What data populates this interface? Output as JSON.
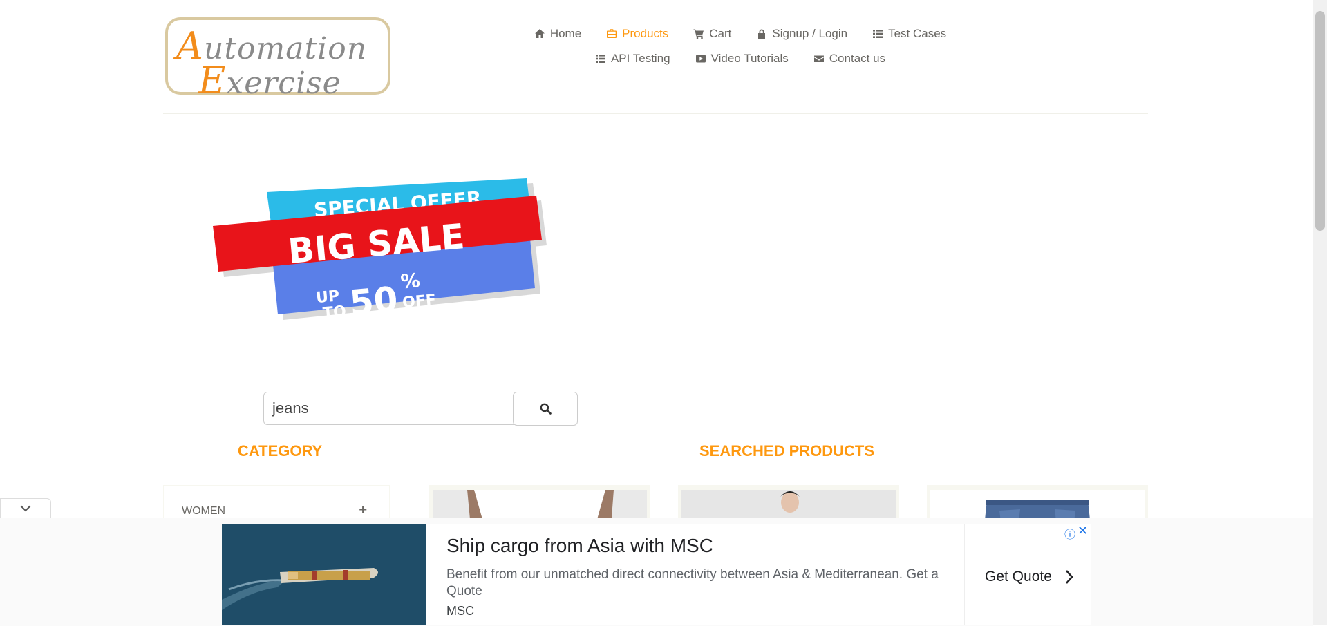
{
  "logo": {
    "line1_cap": "A",
    "line1_rest": "utomation",
    "line2_cap": "E",
    "line2_rest": "xercise"
  },
  "nav": {
    "items": [
      {
        "label": "Home",
        "icon": "home-icon"
      },
      {
        "label": "Products",
        "icon": "briefcase-icon",
        "active": true
      },
      {
        "label": "Cart",
        "icon": "cart-icon"
      },
      {
        "label": "Signup / Login",
        "icon": "lock-icon"
      },
      {
        "label": "Test Cases",
        "icon": "list-icon"
      },
      {
        "label": "API Testing",
        "icon": "list-icon"
      },
      {
        "label": "Video Tutorials",
        "icon": "youtube-icon"
      },
      {
        "label": "Contact us",
        "icon": "envelope-icon"
      }
    ]
  },
  "banner": {
    "line1": "SPECIAL OFFER",
    "line2": "BIG SALE",
    "up": "UP",
    "to": "TO",
    "pct": "50",
    "pct_sign": "%",
    "off": "OFF"
  },
  "search": {
    "value": "jeans",
    "icon": "search-icon"
  },
  "sections": {
    "category": "CATEGORY",
    "searched": "SEARCHED PRODUCTS"
  },
  "category": {
    "items": [
      {
        "label": "WOMEN",
        "toggle": "+"
      }
    ]
  },
  "ad": {
    "title": "Ship cargo from Asia with MSC",
    "description": "Benefit from our unmatched direct connectivity between Asia & Mediterranean. Get a Quote",
    "brand": "MSC",
    "cta": "Get Quote",
    "close": "✕",
    "info": "ⓘ"
  },
  "colors": {
    "accent": "#fe980f",
    "text": "#696763",
    "banner_blue": "#2bbbe8",
    "banner_red": "#e8141a",
    "banner_violet": "#5a7fe8"
  }
}
